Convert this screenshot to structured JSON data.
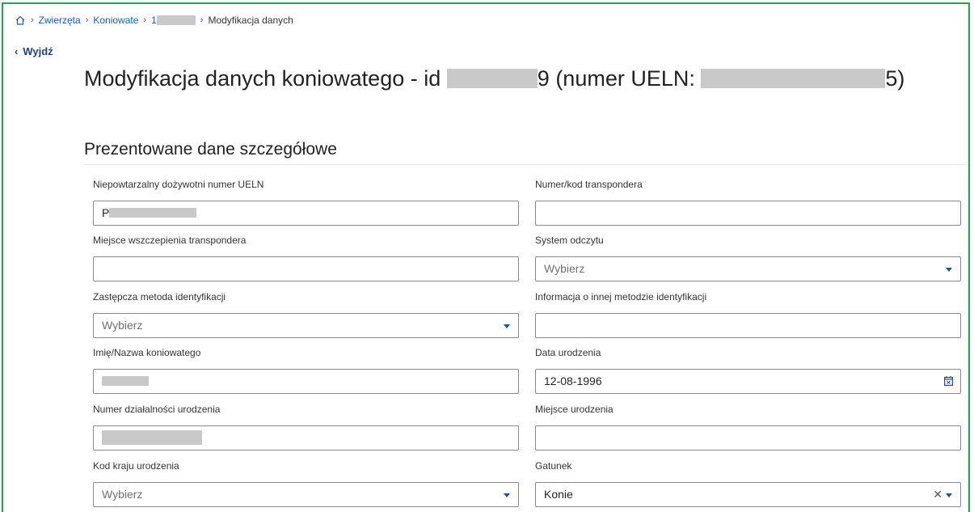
{
  "breadcrumb": {
    "items": [
      "Zwierzęta",
      "Koniowate",
      "1",
      "Modyfikacja danych"
    ]
  },
  "nav": {
    "back_label": "Wyjdź"
  },
  "header": {
    "title_prefix": "Modyfikacja danych koniowatego - id",
    "title_id_tail": "9",
    "title_ueln_prefix": "(numer UELN:",
    "title_ueln_tail": "5)"
  },
  "section": {
    "title": "Prezentowane dane szczegółowe"
  },
  "fields": {
    "ueln": {
      "label": "Niepowtarzalny dożywotni numer UELN",
      "value": "P"
    },
    "transponder_number": {
      "label": "Numer/kod transpondera",
      "value": ""
    },
    "transponder_place": {
      "label": "Miejsce wszczepienia transpondera",
      "value": ""
    },
    "reading_system": {
      "label": "System odczytu",
      "placeholder": "Wybierz"
    },
    "alt_id_method": {
      "label": "Zastępcza metoda identyfikacji",
      "placeholder": "Wybierz"
    },
    "other_id_info": {
      "label": "Informacja o innej metodzie identyfikacji",
      "value": ""
    },
    "name": {
      "label": "Imię/Nazwa koniowatego",
      "value": ""
    },
    "birth_date": {
      "label": "Data urodzenia",
      "value": "12-08-1996"
    },
    "birth_holding": {
      "label": "Numer działalności urodzenia",
      "value": ""
    },
    "birth_place": {
      "label": "Miejsce urodzenia",
      "value": ""
    },
    "birth_country": {
      "label": "Kod kraju urodzenia",
      "placeholder": "Wybierz"
    },
    "species": {
      "label": "Gatunek",
      "value": "Konie"
    }
  },
  "icons": {
    "home": "home-icon",
    "back": "chevron-left-icon",
    "caret": "chevron-down-icon",
    "clear": "close-icon",
    "calendar": "calendar-icon"
  },
  "colors": {
    "link": "#1f5aa6",
    "frame": "#1aa84a",
    "caret": "#1f4f96"
  }
}
